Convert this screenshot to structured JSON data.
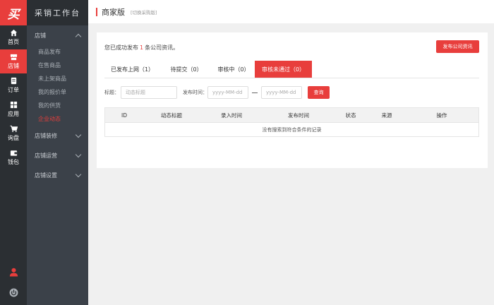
{
  "app": {
    "logo_text": "买",
    "brand": "采销工作台"
  },
  "rail": {
    "items": [
      {
        "label": "首页",
        "icon": "home-icon"
      },
      {
        "label": "店铺",
        "icon": "store-icon",
        "active": true
      },
      {
        "label": "订单",
        "icon": "order-icon"
      },
      {
        "label": "应用",
        "icon": "apps-icon"
      },
      {
        "label": "询盘",
        "icon": "cart-icon"
      },
      {
        "label": "钱包",
        "icon": "wallet-icon"
      }
    ],
    "bottom_icons": [
      "user-icon",
      "power-icon"
    ]
  },
  "subnav": {
    "groups": [
      {
        "label": "店铺",
        "expanded": true,
        "items": [
          "商品发布",
          "在售商品",
          "未上架商品",
          "我的报价单",
          "我的供货",
          "企业动态"
        ],
        "active_item": "企业动态"
      },
      {
        "label": "店铺装修",
        "expanded": false
      },
      {
        "label": "店铺运营",
        "expanded": false
      },
      {
        "label": "店铺设置",
        "expanded": false
      }
    ]
  },
  "header": {
    "title": "商家版",
    "switch_link": "[切换采购版]"
  },
  "notice": {
    "prefix": "您已成功发布",
    "count": "1",
    "suffix": "条公司资讯。"
  },
  "publish_button": "发布公司资讯",
  "tabs": [
    {
      "label": "已发布上网（1）"
    },
    {
      "label": "待提交（0）"
    },
    {
      "label": "审核中（0）"
    },
    {
      "label": "审核未通过（0）",
      "active": true
    }
  ],
  "filters": {
    "title_label": "标题：",
    "title_placeholder": "动态标题",
    "date_label": "发布时间：",
    "date_from_placeholder": "yyyy-MM-dd",
    "date_to_placeholder": "yyyy-MM-dd",
    "search_button": "查询"
  },
  "table": {
    "columns": [
      "ID",
      "动态标题",
      "录入时间",
      "发布时间",
      "状态",
      "来源",
      "操作"
    ],
    "empty_text": "没有搜索到符合条件的记录"
  },
  "colors": {
    "accent": "#e83e3c",
    "rail_bg": "#2b2f33",
    "subnav_bg": "#3b4149"
  }
}
